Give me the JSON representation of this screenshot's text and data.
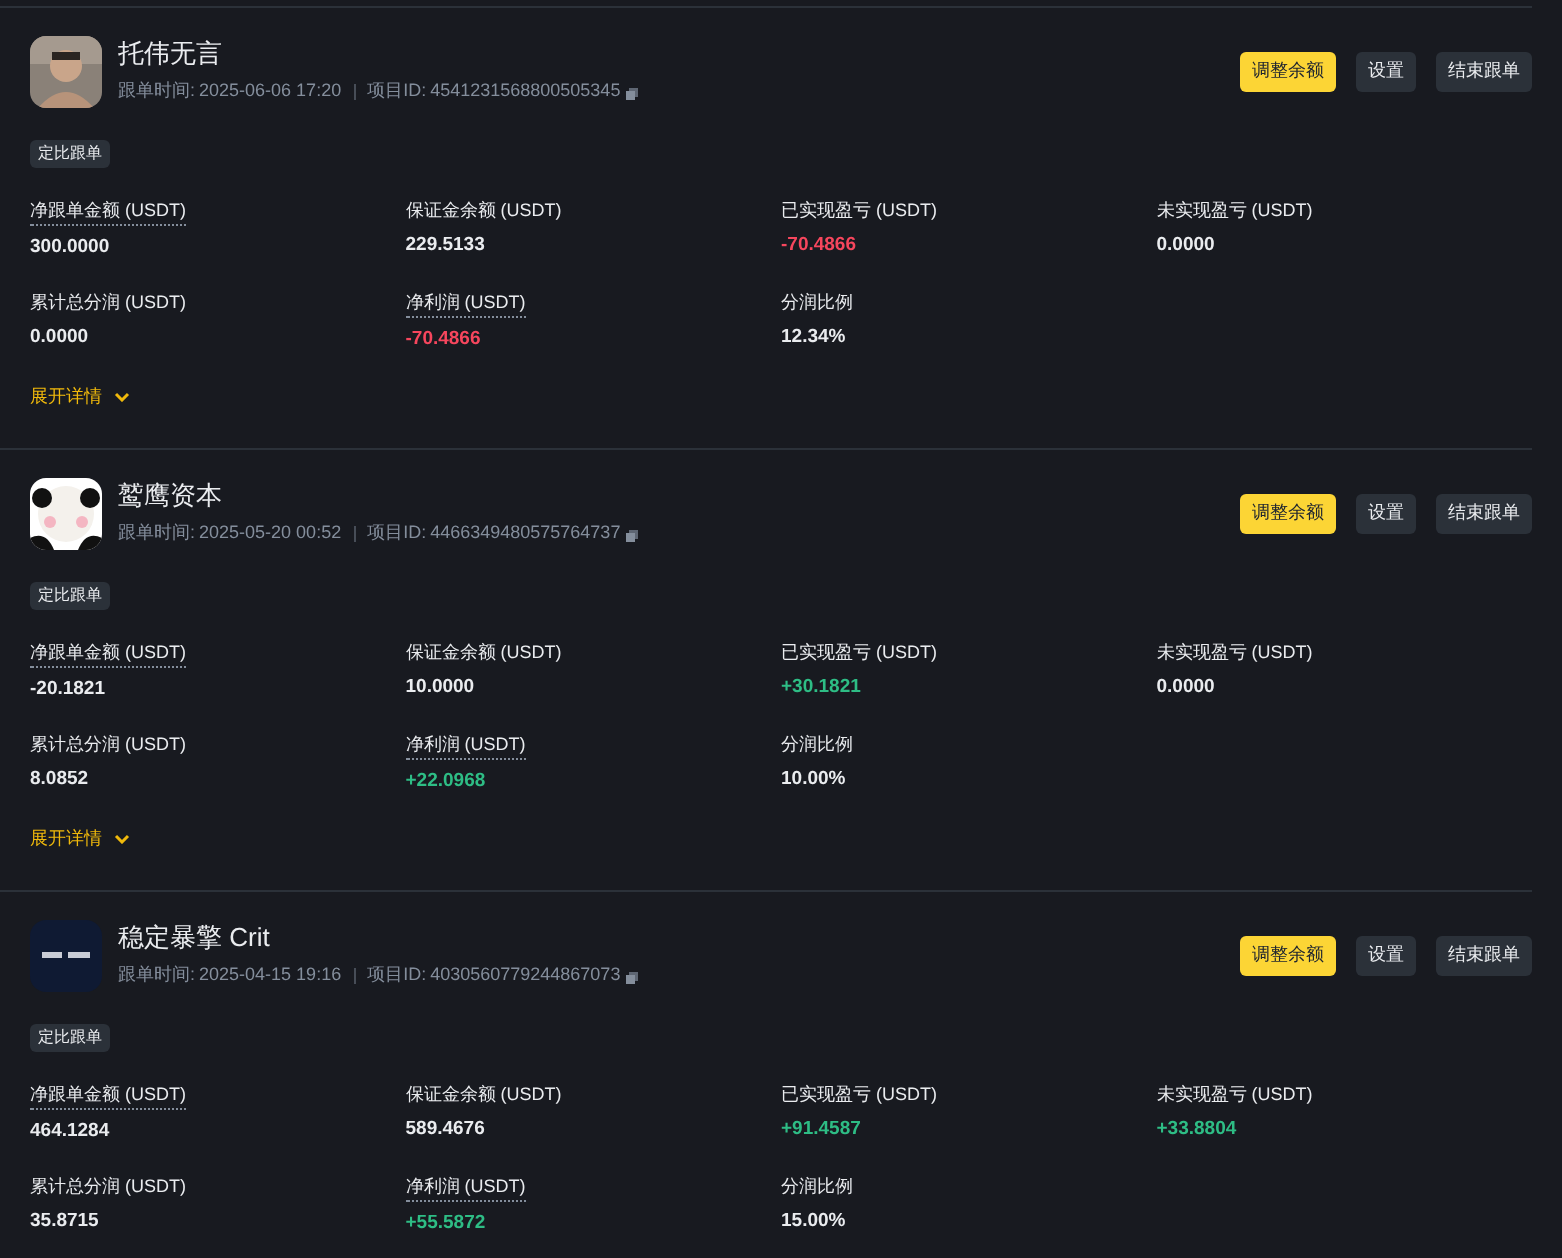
{
  "cards": [
    {
      "name": "托伟无言",
      "time_label": "跟单时间:",
      "time": "2025-06-06 17:20",
      "id_label": "项目ID:",
      "id": "4541231568800505345",
      "buttons": [
        {
          "label": "调整余额",
          "primary": true
        },
        {
          "label": "设置",
          "primary": false
        },
        {
          "label": "结束跟单",
          "primary": false
        }
      ],
      "tag": "定比跟单",
      "stats": [
        {
          "label": "净跟单金额 (USDT)",
          "value": "300.0000",
          "dotted": true,
          "color": "#eaecef"
        },
        {
          "label": "保证金余额 (USDT)",
          "value": "229.5133",
          "dotted": false,
          "color": "#eaecef"
        },
        {
          "label": "已实现盈亏 (USDT)",
          "value": "-70.4866",
          "dotted": false,
          "color": "#f6465d"
        },
        {
          "label": "未实现盈亏 (USDT)",
          "value": "0.0000",
          "dotted": false,
          "color": "#eaecef"
        },
        {
          "label": "累计总分润 (USDT)",
          "value": "0.0000",
          "dotted": false,
          "color": "#eaecef"
        },
        {
          "label": "净利润 (USDT)",
          "value": "-70.4866",
          "dotted": true,
          "color": "#f6465d"
        },
        {
          "label": "分润比例",
          "value": "12.34%",
          "dotted": false,
          "color": "#eaecef"
        }
      ],
      "expand": "展开详情"
    },
    {
      "name": "鹫鹰资本",
      "time_label": "跟单时间:",
      "time": "2025-05-20 00:52",
      "id_label": "项目ID:",
      "id": "4466349480575764737",
      "buttons": [
        {
          "label": "调整余额",
          "primary": true
        },
        {
          "label": "设置",
          "primary": false
        },
        {
          "label": "结束跟单",
          "primary": false
        }
      ],
      "tag": "定比跟单",
      "stats": [
        {
          "label": "净跟单金额 (USDT)",
          "value": "-20.1821",
          "dotted": true,
          "color": "#eaecef"
        },
        {
          "label": "保证金余额 (USDT)",
          "value": "10.0000",
          "dotted": false,
          "color": "#eaecef"
        },
        {
          "label": "已实现盈亏 (USDT)",
          "value": "+30.1821",
          "dotted": false,
          "color": "#2ebd85"
        },
        {
          "label": "未实现盈亏 (USDT)",
          "value": "0.0000",
          "dotted": false,
          "color": "#eaecef"
        },
        {
          "label": "累计总分润 (USDT)",
          "value": "8.0852",
          "dotted": false,
          "color": "#eaecef"
        },
        {
          "label": "净利润 (USDT)",
          "value": "+22.0968",
          "dotted": true,
          "color": "#2ebd85"
        },
        {
          "label": "分润比例",
          "value": "10.00%",
          "dotted": false,
          "color": "#eaecef"
        }
      ],
      "expand": "展开详情"
    },
    {
      "name": "稳定暴擎 Crit",
      "time_label": "跟单时间:",
      "time": "2025-04-15 19:16",
      "id_label": "项目ID:",
      "id": "4030560779244867073",
      "buttons": [
        {
          "label": "调整余额",
          "primary": true
        },
        {
          "label": "设置",
          "primary": false
        },
        {
          "label": "结束跟单",
          "primary": false
        }
      ],
      "tag": "定比跟单",
      "stats": [
        {
          "label": "净跟单金额 (USDT)",
          "value": "464.1284",
          "dotted": true,
          "color": "#eaecef"
        },
        {
          "label": "保证金余额 (USDT)",
          "value": "589.4676",
          "dotted": false,
          "color": "#eaecef"
        },
        {
          "label": "已实现盈亏 (USDT)",
          "value": "+91.4587",
          "dotted": false,
          "color": "#2ebd85"
        },
        {
          "label": "未实现盈亏 (USDT)",
          "value": "+33.8804",
          "dotted": false,
          "color": "#2ebd85"
        },
        {
          "label": "累计总分润 (USDT)",
          "value": "35.8715",
          "dotted": false,
          "color": "#eaecef"
        },
        {
          "label": "净利润 (USDT)",
          "value": "+55.5872",
          "dotted": true,
          "color": "#2ebd85"
        },
        {
          "label": "分润比例",
          "value": "15.00%",
          "dotted": false,
          "color": "#eaecef"
        }
      ]
    }
  ]
}
